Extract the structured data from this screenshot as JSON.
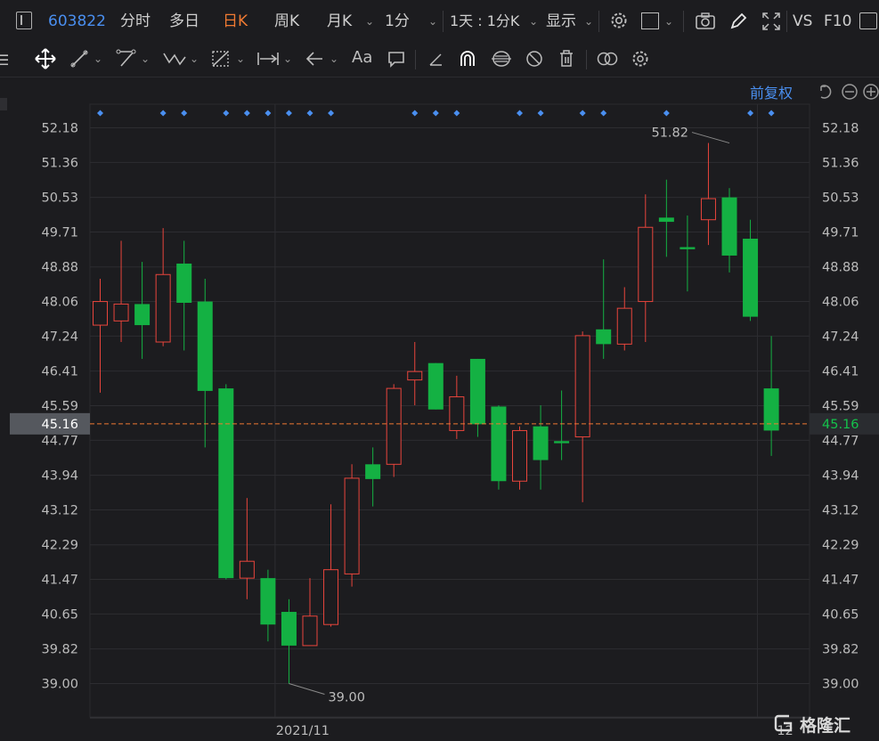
{
  "toolbar": {
    "symbol": "603822",
    "tabs": [
      {
        "label": "分时",
        "active": false
      },
      {
        "label": "多日",
        "active": false
      },
      {
        "label": "日K",
        "active": true
      },
      {
        "label": "周K",
        "active": false
      },
      {
        "label": "月K",
        "active": false
      },
      {
        "label": "1分",
        "active": false
      }
    ],
    "range_label": "1天 : 1分K",
    "display_label": "显示",
    "vs_label": "VS",
    "f10_label": "F10"
  },
  "adjust_label": "前复权",
  "watermark": "格隆汇",
  "colors": {
    "up": "#e8453c",
    "down": "#14b143",
    "bg": "#1c1c1f",
    "grid": "#2d2d31",
    "accent": "#4a8ff0",
    "current": "#f07a32"
  },
  "chart_data": {
    "type": "candlestick",
    "title": "",
    "xlabel": "",
    "ylabel": "",
    "ylim": [
      38.5,
      52.7
    ],
    "y_ticks": [
      "52.18",
      "51.36",
      "50.53",
      "49.71",
      "48.88",
      "48.06",
      "47.24",
      "46.41",
      "45.59",
      "44.77",
      "43.94",
      "43.12",
      "42.29",
      "41.47",
      "40.65",
      "39.82",
      "39.00"
    ],
    "x_ticks": [
      {
        "label": "2021/11",
        "index": 8
      },
      {
        "label": "12",
        "index": 31
      }
    ],
    "current_price": "45.16",
    "annotations": [
      {
        "label": "51.82",
        "index": 30
      },
      {
        "label": "39.00",
        "index": 9
      }
    ],
    "event_marker_indices": [
      0,
      3,
      4,
      6,
      7,
      8,
      9,
      10,
      11,
      15,
      16,
      17,
      20,
      21,
      23,
      24,
      27,
      31,
      32
    ],
    "candles": [
      {
        "o": 47.5,
        "h": 48.6,
        "l": 45.9,
        "c": 48.06
      },
      {
        "o": 47.6,
        "h": 49.5,
        "l": 47.1,
        "c": 48.0
      },
      {
        "o": 48.0,
        "h": 49.0,
        "l": 46.7,
        "c": 47.5
      },
      {
        "o": 47.1,
        "h": 49.8,
        "l": 47.0,
        "c": 48.7
      },
      {
        "o": 48.96,
        "h": 49.5,
        "l": 46.9,
        "c": 48.03
      },
      {
        "o": 48.06,
        "h": 48.6,
        "l": 44.6,
        "c": 45.94
      },
      {
        "o": 46.0,
        "h": 46.1,
        "l": 41.47,
        "c": 41.5
      },
      {
        "o": 41.5,
        "h": 43.4,
        "l": 41.0,
        "c": 41.9
      },
      {
        "o": 41.5,
        "h": 41.7,
        "l": 40.0,
        "c": 40.4
      },
      {
        "o": 40.7,
        "h": 41.0,
        "l": 39.0,
        "c": 39.9
      },
      {
        "o": 39.9,
        "h": 41.5,
        "l": 39.9,
        "c": 40.6
      },
      {
        "o": 40.4,
        "h": 43.25,
        "l": 40.35,
        "c": 41.7
      },
      {
        "o": 41.6,
        "h": 44.2,
        "l": 41.3,
        "c": 43.87
      },
      {
        "o": 44.2,
        "h": 44.6,
        "l": 43.2,
        "c": 43.85
      },
      {
        "o": 44.2,
        "h": 46.1,
        "l": 43.9,
        "c": 46.0
      },
      {
        "o": 46.2,
        "h": 47.1,
        "l": 45.6,
        "c": 46.4
      },
      {
        "o": 46.6,
        "h": 46.6,
        "l": 45.5,
        "c": 45.5
      },
      {
        "o": 45.0,
        "h": 46.3,
        "l": 44.8,
        "c": 45.8
      },
      {
        "o": 46.7,
        "h": 46.7,
        "l": 44.85,
        "c": 45.15
      },
      {
        "o": 45.57,
        "h": 45.6,
        "l": 43.6,
        "c": 43.8
      },
      {
        "o": 43.8,
        "h": 45.1,
        "l": 43.6,
        "c": 45.0
      },
      {
        "o": 45.1,
        "h": 45.6,
        "l": 43.6,
        "c": 44.3
      },
      {
        "o": 44.75,
        "h": 45.95,
        "l": 44.3,
        "c": 44.7
      },
      {
        "o": 44.85,
        "h": 47.35,
        "l": 43.3,
        "c": 47.25
      },
      {
        "o": 47.4,
        "h": 49.06,
        "l": 46.7,
        "c": 47.05
      },
      {
        "o": 47.05,
        "h": 48.4,
        "l": 46.9,
        "c": 47.9
      },
      {
        "o": 48.06,
        "h": 50.6,
        "l": 47.1,
        "c": 49.82
      },
      {
        "o": 50.05,
        "h": 50.95,
        "l": 49.12,
        "c": 49.95
      },
      {
        "o": 49.35,
        "h": 50.1,
        "l": 48.3,
        "c": 49.3
      },
      {
        "o": 50.0,
        "h": 51.82,
        "l": 49.4,
        "c": 50.5
      },
      {
        "o": 50.53,
        "h": 50.75,
        "l": 48.75,
        "c": 49.15
      },
      {
        "o": 49.55,
        "h": 50.0,
        "l": 47.6,
        "c": 47.7
      },
      {
        "o": 46.0,
        "h": 47.24,
        "l": 44.4,
        "c": 45.0
      }
    ]
  }
}
